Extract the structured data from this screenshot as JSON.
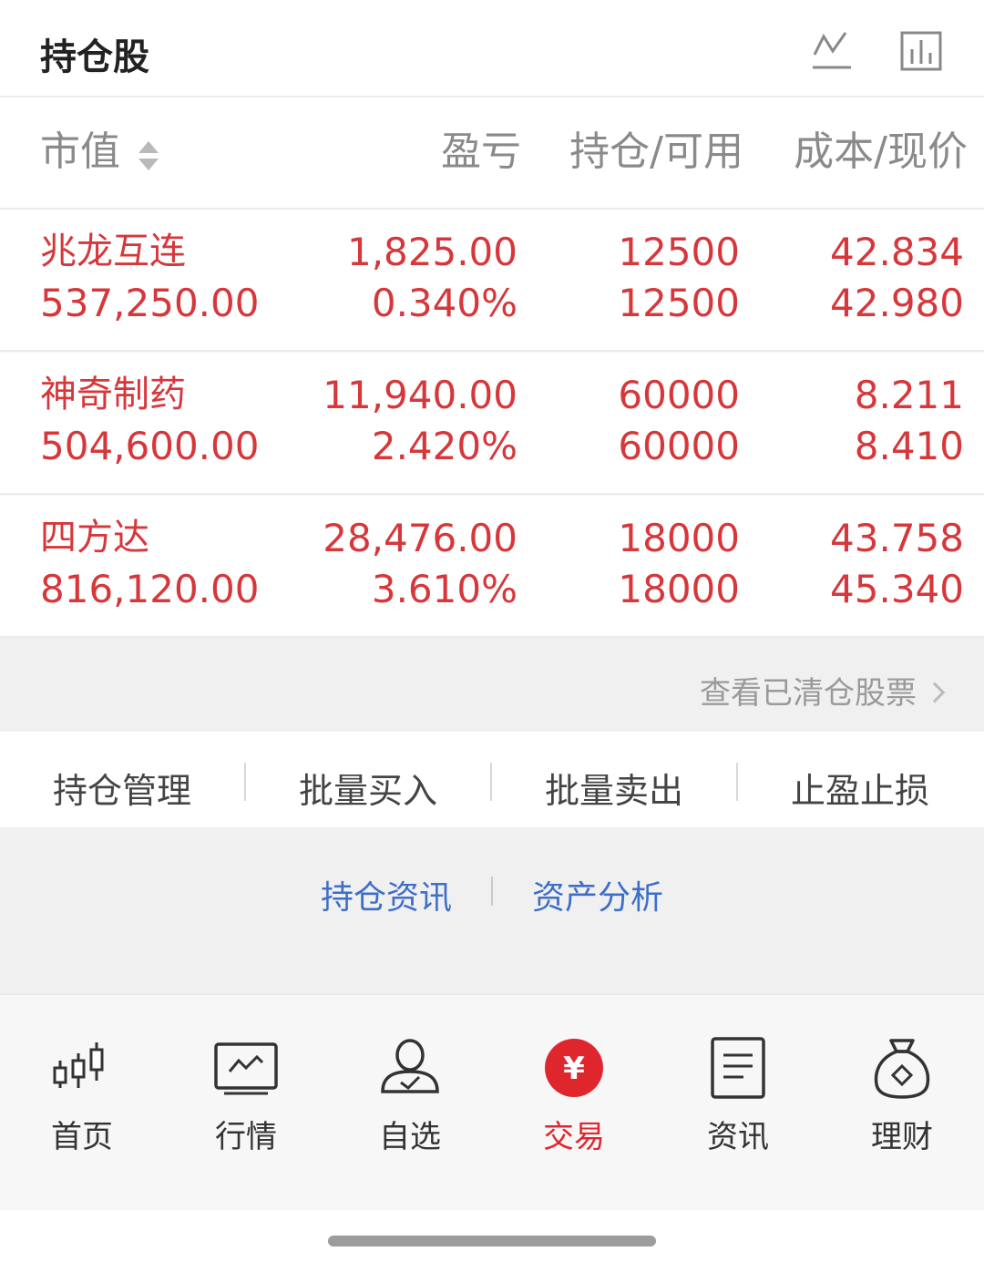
{
  "header": {
    "title": "持仓股",
    "line_chart_icon": "line-chart-icon",
    "bar_chart_icon": "bar-chart-icon"
  },
  "columns": {
    "market_value": "市值",
    "profit_loss": "盈亏",
    "holding_available": "持仓/可用",
    "cost_price": "成本/现价"
  },
  "holdings": [
    {
      "name": "兆龙互连",
      "market_value": "537,250.00",
      "profit": "1,825.00",
      "profit_pct": "0.340%",
      "holding": "12500",
      "available": "12500",
      "cost": "42.834",
      "price": "42.980"
    },
    {
      "name": "神奇制药",
      "market_value": "504,600.00",
      "profit": "11,940.00",
      "profit_pct": "2.420%",
      "holding": "60000",
      "available": "60000",
      "cost": "8.211",
      "price": "8.410"
    },
    {
      "name": "四方达",
      "market_value": "816,120.00",
      "profit": "28,476.00",
      "profit_pct": "3.610%",
      "holding": "18000",
      "available": "18000",
      "cost": "43.758",
      "price": "45.340"
    }
  ],
  "cleared_link": "查看已清仓股票",
  "actions": [
    "持仓管理",
    "批量买入",
    "批量卖出",
    "止盈止损"
  ],
  "links": [
    "持仓资讯",
    "资产分析"
  ],
  "tabs": [
    {
      "label": "首页",
      "icon": "candlestick-icon"
    },
    {
      "label": "行情",
      "icon": "chart-monitor-icon"
    },
    {
      "label": "自选",
      "icon": "user-check-icon"
    },
    {
      "label": "交易",
      "icon": "yen-circle-icon",
      "active": true
    },
    {
      "label": "资讯",
      "icon": "document-icon"
    },
    {
      "label": "理财",
      "icon": "money-bag-icon"
    }
  ],
  "colors": {
    "up": "#d6373b",
    "link": "#3d6fc9",
    "active_tab": "#e0262d"
  }
}
